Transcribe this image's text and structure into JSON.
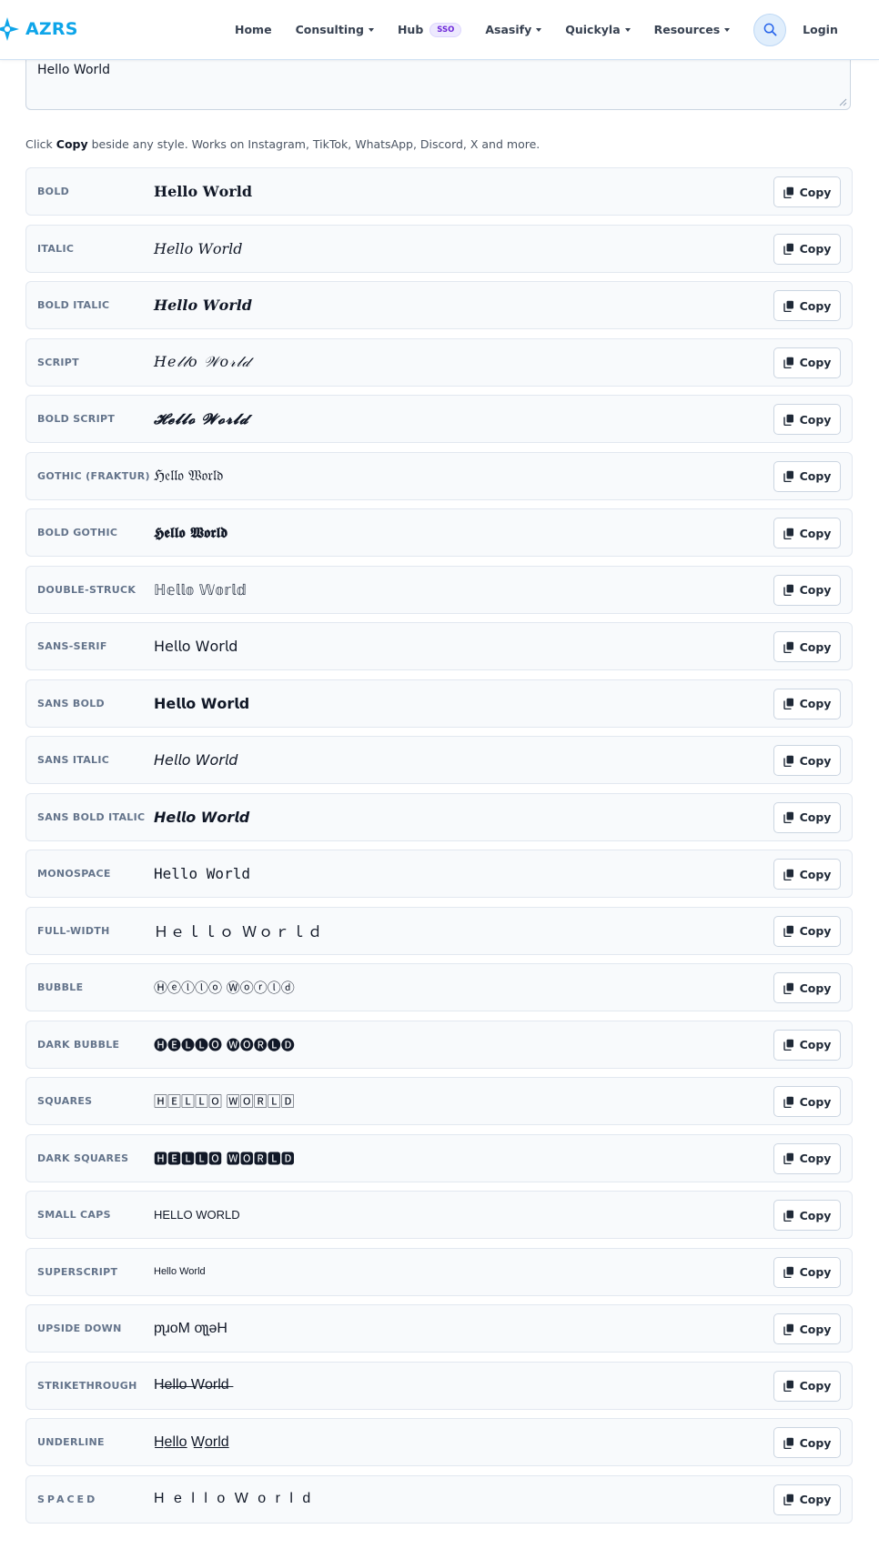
{
  "navbar": {
    "brand": "AZRS",
    "links": [
      {
        "label": "Home",
        "dropdown": false
      },
      {
        "label": "Consulting",
        "dropdown": true
      },
      {
        "label": "Hub",
        "badge": "SSO",
        "dropdown": false
      },
      {
        "label": "Asasify",
        "dropdown": true
      },
      {
        "label": "Quickyla",
        "dropdown": true
      },
      {
        "label": "Resources",
        "dropdown": true
      }
    ],
    "search_icon": "search-icon",
    "login": "Login"
  },
  "input": {
    "value": "Hello World"
  },
  "hint": {
    "before": "Click ",
    "emphasis": "Copy",
    "after": " beside any style. Works on Instagram, TikTok, WhatsApp, Discord, X and more."
  },
  "copy_label": "Copy",
  "styles": [
    {
      "label": "BOLD",
      "preview": "𝐇𝐞𝐥𝐥𝐨 𝐖𝐨𝐫𝐥𝐝"
    },
    {
      "label": "ITALIC",
      "preview": "𝐻𝑒𝑙𝑙𝑜 𝑊𝑜𝑟𝑙𝑑"
    },
    {
      "label": "BOLD ITALIC",
      "preview": "𝑯𝒆𝒍𝒍𝒐 𝑾𝒐𝒓𝒍𝒅"
    },
    {
      "label": "SCRIPT",
      "preview": "𝐻𝑒𝓁𝓁𝑜 𝒲𝑜𝓇𝓁𝒹"
    },
    {
      "label": "BOLD SCRIPT",
      "preview": "𝓗𝓮𝓵𝓵𝓸 𝓦𝓸𝓻𝓵𝓭"
    },
    {
      "label": "GOTHIC (FRAKTUR)",
      "preview": "ℌ𝔢𝔩𝔩𝔬 𝔚𝔬𝔯𝔩𝔡"
    },
    {
      "label": "BOLD GOTHIC",
      "preview": "𝕳𝖊𝖑𝖑𝖔 𝖂𝖔𝖗𝖑𝖉"
    },
    {
      "label": "DOUBLE-STRUCK",
      "preview": "ℍ𝕖𝕝𝕝𝕠 𝕎𝕠𝕣𝕝𝕕"
    },
    {
      "label": "SANS-SERIF",
      "preview": "𝖧𝖾𝗅𝗅𝗈 𝖶𝗈𝗋𝗅𝖽"
    },
    {
      "label": "SANS BOLD",
      "preview": "𝗛𝗲𝗹𝗹𝗼 𝗪𝗼𝗿𝗹𝗱"
    },
    {
      "label": "SANS ITALIC",
      "preview": "𝘏𝘦𝘭𝘭𝘰 𝘞𝘰𝘳𝘭𝘥"
    },
    {
      "label": "SANS BOLD ITALIC",
      "preview": "𝙃𝙚𝙡𝙡𝙤 𝙒𝙤𝙧𝙡𝙙"
    },
    {
      "label": "MONOSPACE",
      "preview": "𝙷𝚎𝚕𝚕𝚘 𝚆𝚘𝚛𝚕𝚍"
    },
    {
      "label": "FULL-WIDTH",
      "preview": "Ｈｅｌｌｏ Ｗｏｒｌｄ"
    },
    {
      "label": "BUBBLE",
      "preview": "Ⓗⓔⓛⓛⓞ Ⓦⓞⓡⓛⓓ"
    },
    {
      "label": "DARK BUBBLE",
      "preview": "🅗🅔🅛🅛🅞 🅦🅞🅡🅛🅓"
    },
    {
      "label": "SQUARES",
      "preview": "🄷🄴🄻🄻🄾 🅆🄾🅁🄻🄳"
    },
    {
      "label": "DARK SQUARES",
      "preview": "🅷🅴🅻🅻🅾 🆆🅾🆁🅻🅳"
    },
    {
      "label": "SMALL CAPS",
      "preview": "HELLO WORLD"
    },
    {
      "label": "SUPERSCRIPT",
      "preview": "Hello World"
    },
    {
      "label": "UPSIDE DOWN",
      "preview": "pʅɹoM oʅʅǝH"
    },
    {
      "label": "STRIKETHROUGH",
      "preview": "H̶e̶l̶l̶o̶ ̶W̶o̶r̶l̶d̶"
    },
    {
      "label": "UNDERLINE",
      "preview": "H̲e̲l̲l̲o̲ W̲o̲r̲l̲d̲"
    },
    {
      "label": "SPACED",
      "preview": "H e l l o W o r l d"
    }
  ]
}
